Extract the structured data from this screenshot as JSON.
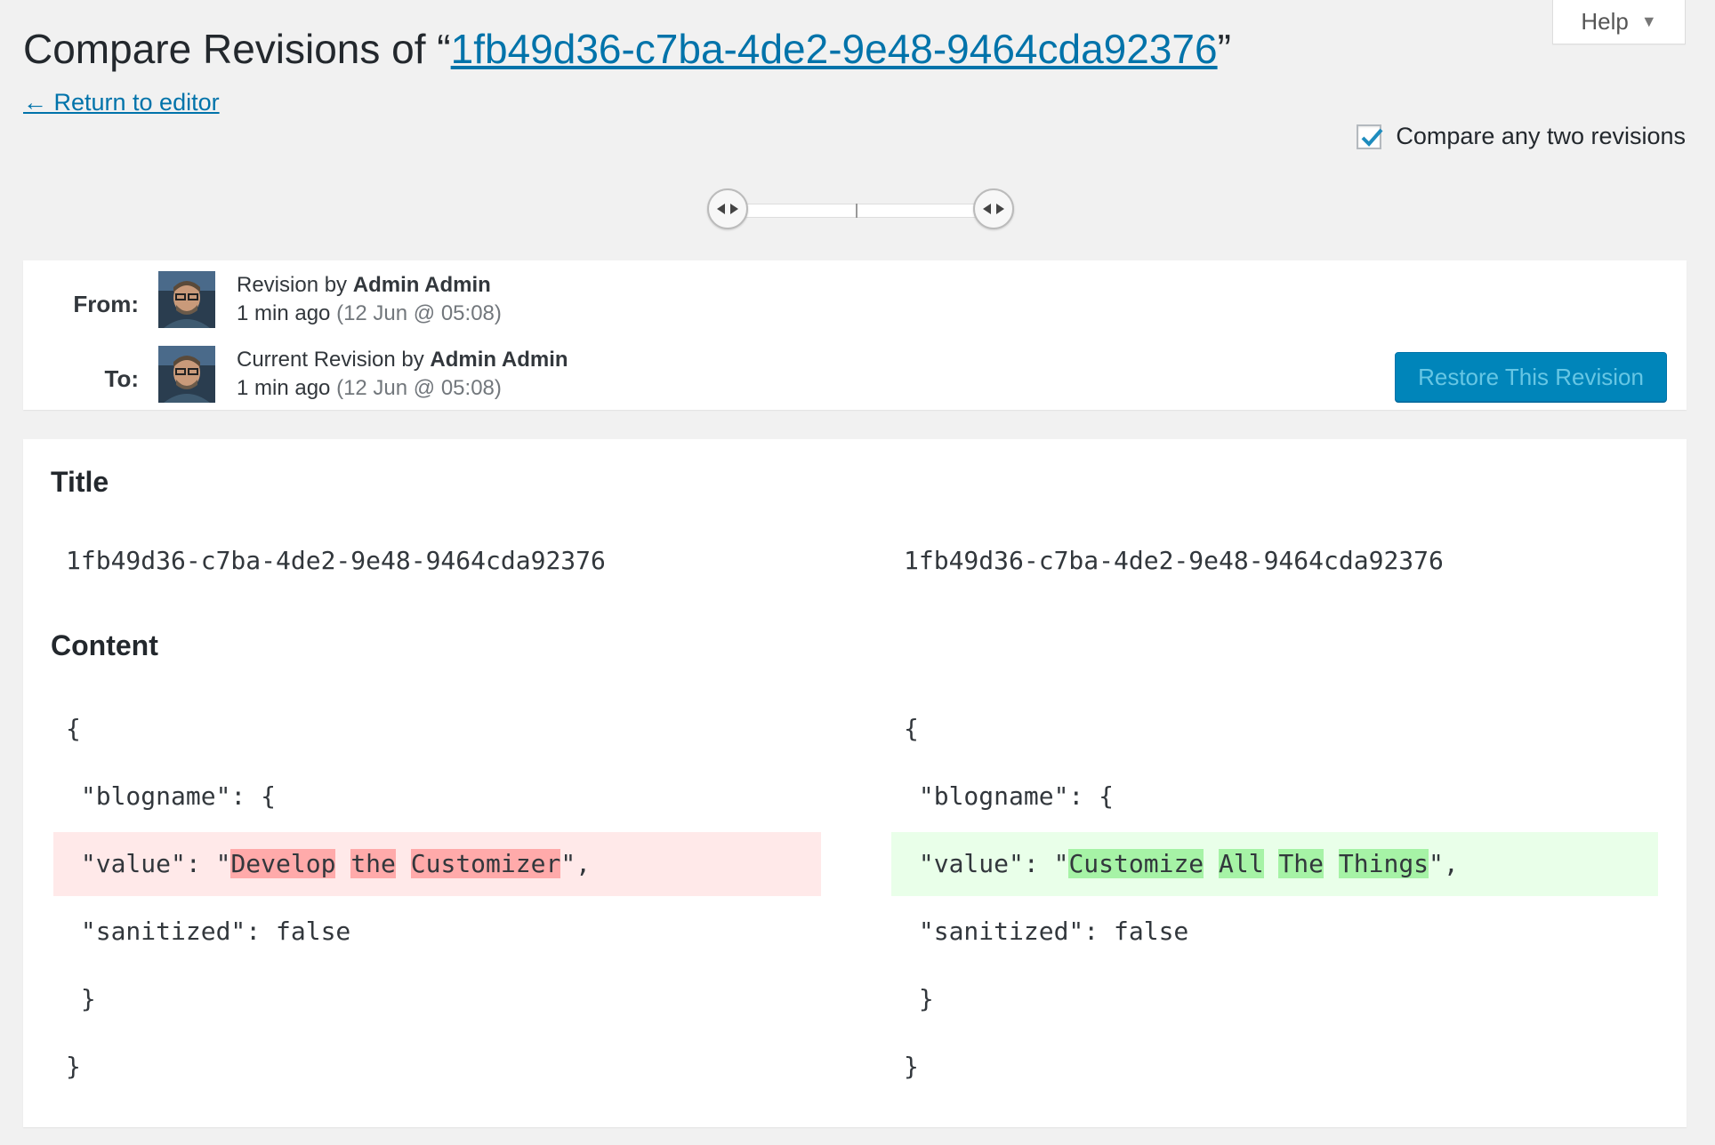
{
  "help": {
    "label": "Help"
  },
  "header": {
    "title_prefix": "Compare Revisions of “",
    "title_link": "1fb49d36-c7ba-4de2-9e48-9464cda92376",
    "title_suffix": "”",
    "return_link": "← Return to editor"
  },
  "compare_two": {
    "label": "Compare any two revisions",
    "checked": true
  },
  "meta": {
    "from": {
      "label": "From:",
      "prefix": "Revision by ",
      "author": "Admin Admin",
      "ago": "1 min ago",
      "date": "(12 Jun @ 05:08)"
    },
    "to": {
      "label": "To:",
      "prefix": "Current Revision by ",
      "author": "Admin Admin",
      "ago": "1 min ago",
      "date": "(12 Jun @ 05:08)"
    },
    "restore_button": "Restore This Revision"
  },
  "diff": {
    "title_heading": "Title",
    "title_left": "1fb49d36-c7ba-4de2-9e48-9464cda92376",
    "title_right": "1fb49d36-c7ba-4de2-9e48-9464cda92376",
    "content_heading": "Content",
    "left": {
      "l1": "{",
      "l2": " \"blogname\": {",
      "l3_pre": " \"value\": \"",
      "l3_w1": "Develop",
      "l3_w2": "the",
      "l3_w3": "Customizer",
      "l3_post": "\",",
      "l4": " \"sanitized\": false",
      "l5": " }",
      "l6": "}"
    },
    "right": {
      "l1": "{",
      "l2": " \"blogname\": {",
      "l3_pre": " \"value\": \"",
      "l3_w1": "Customize",
      "l3_w2": "All",
      "l3_w3": "The",
      "l3_w4": "Things",
      "l3_post": "\",",
      "l4": " \"sanitized\": false",
      "l5": " }",
      "l6": "}"
    }
  },
  "colors": {
    "link": "#0073aa",
    "primary_button": "#0085ba",
    "removed_line": "#ffe9e9",
    "removed_word": "#ffaaaa",
    "added_line": "#e9ffe9",
    "added_word": "#a6f3a6"
  }
}
